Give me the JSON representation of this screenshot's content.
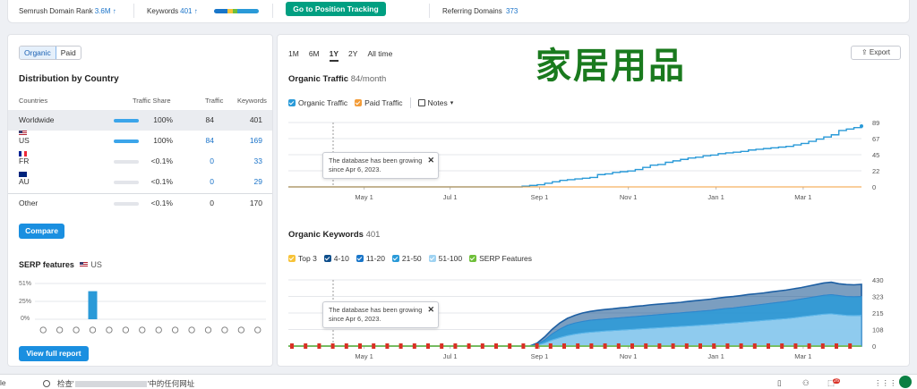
{
  "top": {
    "rank_label": "Semrush Domain Rank",
    "rank_value": "3.6M ↑",
    "keywords_label": "Keywords",
    "keywords_value": "401 ↑",
    "cta": "Go to Position Tracking",
    "ref_label": "Referring Domains",
    "ref_value": "373"
  },
  "left": {
    "toggle": [
      "Organic",
      "Paid"
    ],
    "dist_title": "Distribution by Country",
    "columns": [
      "Countries",
      "Traffic Share",
      "Traffic",
      "Keywords"
    ],
    "rows": [
      {
        "name": "Worldwide",
        "share": "100%",
        "share_value": 1.0,
        "traffic": "84",
        "keywords": "401",
        "flag": ""
      },
      {
        "name": "US",
        "share": "100%",
        "share_value": 1.0,
        "traffic": "84",
        "keywords": "169",
        "flag": "us"
      },
      {
        "name": "FR",
        "share": "<0.1%",
        "share_value": 0.0,
        "traffic": "0",
        "keywords": "33",
        "flag": "fr"
      },
      {
        "name": "AU",
        "share": "<0.1%",
        "share_value": 0.0,
        "traffic": "0",
        "keywords": "29",
        "flag": "au"
      },
      {
        "name": "Other",
        "share": "<0.1%",
        "share_value": 0.0,
        "traffic": "0",
        "keywords": "170",
        "flag": ""
      }
    ],
    "compare": "Compare",
    "serp_title": "SERP features",
    "serp_country": "US",
    "serp_yticks": [
      "51%",
      "25%",
      "0%"
    ],
    "view_report": "View full report"
  },
  "right": {
    "ranges": [
      "1M",
      "6M",
      "1Y",
      "2Y",
      "All time"
    ],
    "selected_range": "1Y",
    "heading_cn": "家居用品",
    "export": "Export",
    "ot_title": "Organic Traffic",
    "ot_value": "84/month",
    "ot_legend": [
      "Organic Traffic",
      "Paid Traffic"
    ],
    "notes": "Notes",
    "tip_line1": "The database has been growing",
    "tip_line2": "since Apr 6, 2023.",
    "ok_title": "Organic Keywords",
    "ok_value": "401",
    "ok_legend": [
      "Top 3",
      "4-10",
      "11-20",
      "21-50",
      "51-100",
      "SERP Features"
    ]
  },
  "colors": {
    "organic": "#2a9ad8",
    "paid": "#f39c38",
    "top3": "#f7c338",
    "pos4_10": "#0f4f8c",
    "pos11_20": "#1976c9",
    "pos21_50": "#2a9ad8",
    "pos51_100": "#9fd3f2",
    "serp": "#6fbf3a",
    "cta": "#009f81"
  },
  "bottom": {
    "left_fragment": "le",
    "search_prefix": "检查'",
    "search_suffix": "'中的任何网址",
    "badge": "26"
  },
  "chart_data": [
    {
      "type": "bar",
      "title": "SERP features",
      "ylim": [
        0,
        51
      ],
      "yticks": [
        "51%",
        "25%",
        "0%"
      ],
      "values": [
        0,
        0,
        0,
        40,
        0,
        0,
        0,
        0,
        0,
        0,
        0,
        0,
        0,
        0
      ]
    },
    {
      "type": "line",
      "title": "Organic Traffic",
      "x_labels": [
        "May 1",
        "Jul 1",
        "Sep 1",
        "Nov 1",
        "Jan 1",
        "Mar 1"
      ],
      "y_ticks": [
        "89",
        "67",
        "45",
        "22",
        "0"
      ],
      "ylim": [
        0,
        89
      ],
      "series": [
        {
          "name": "Organic Traffic",
          "values": [
            0,
            0,
            0,
            0,
            0,
            0,
            0,
            0,
            0,
            0,
            0,
            0,
            0,
            0,
            0,
            0,
            0,
            0,
            0,
            0,
            0,
            0,
            0,
            0,
            0,
            0,
            0,
            0,
            0,
            0,
            0,
            1,
            2,
            3,
            5,
            7,
            9,
            10,
            11,
            12,
            13,
            17,
            18,
            20,
            21,
            22,
            24,
            27,
            30,
            31,
            34,
            36,
            38,
            40,
            41,
            43,
            44,
            46,
            47,
            48,
            49,
            51,
            52,
            53,
            54,
            55,
            56,
            58,
            60,
            63,
            66,
            69,
            72,
            78,
            80,
            82,
            84
          ]
        },
        {
          "name": "Paid Traffic",
          "values": [
            0,
            0,
            0,
            0,
            0,
            0,
            0,
            0,
            0,
            0,
            0,
            0,
            0,
            0,
            0,
            0,
            0,
            0,
            0,
            0,
            0,
            0,
            0,
            0,
            0,
            0,
            0,
            0,
            0,
            0,
            0,
            0,
            0,
            0,
            0,
            0,
            0,
            0,
            0,
            0,
            0,
            0,
            0,
            0,
            0,
            0,
            0,
            0,
            0,
            0,
            0,
            0,
            0,
            0,
            0,
            0,
            0,
            0,
            0,
            0,
            0,
            0,
            0,
            0,
            0,
            0,
            0,
            0,
            0,
            0,
            0,
            0,
            0,
            0,
            0,
            0,
            0
          ]
        }
      ]
    },
    {
      "type": "area",
      "title": "Organic Keywords",
      "x_labels": [
        "May 1",
        "Jul 1",
        "Sep 1",
        "Nov 1",
        "Jan 1",
        "Mar 1"
      ],
      "y_ticks": [
        "430",
        "323",
        "215",
        "108",
        "0"
      ],
      "ylim": [
        0,
        430
      ],
      "series": [
        {
          "name": "4-10",
          "values": [
            0,
            0,
            0,
            0,
            0,
            0,
            0,
            0,
            0,
            0,
            0,
            0,
            0,
            0,
            0,
            0,
            0,
            0,
            0,
            0,
            0,
            0,
            0,
            0,
            0,
            0,
            0,
            0,
            0,
            0,
            0,
            0,
            0,
            20,
            60,
            110,
            150,
            180,
            200,
            215,
            225,
            232,
            238,
            242,
            248,
            252,
            258,
            262,
            268,
            272,
            276,
            280,
            284,
            290,
            295,
            300,
            305,
            312,
            318,
            322,
            328,
            335,
            340,
            345,
            352,
            358,
            364,
            372,
            380,
            390,
            400,
            410,
            415,
            405,
            400,
            398,
            401
          ]
        },
        {
          "name": "21-50",
          "values": [
            0,
            0,
            0,
            0,
            0,
            0,
            0,
            0,
            0,
            0,
            0,
            0,
            0,
            0,
            0,
            0,
            0,
            0,
            0,
            0,
            0,
            0,
            0,
            0,
            0,
            0,
            0,
            0,
            0,
            0,
            0,
            0,
            0,
            12,
            40,
            80,
            110,
            135,
            150,
            160,
            168,
            172,
            176,
            180,
            184,
            188,
            192,
            196,
            200,
            204,
            208,
            212,
            216,
            220,
            224,
            228,
            232,
            238,
            244,
            248,
            254,
            260,
            266,
            272,
            278,
            284,
            290,
            298,
            306,
            314,
            322,
            330,
            334,
            328,
            322,
            320,
            322
          ]
        },
        {
          "name": "51-100",
          "values": [
            0,
            0,
            0,
            0,
            0,
            0,
            0,
            0,
            0,
            0,
            0,
            0,
            0,
            0,
            0,
            0,
            0,
            0,
            0,
            0,
            0,
            0,
            0,
            0,
            0,
            0,
            0,
            0,
            0,
            0,
            0,
            0,
            0,
            6,
            20,
            40,
            55,
            68,
            78,
            85,
            90,
            94,
            98,
            101,
            104,
            107,
            110,
            113,
            116,
            119,
            122,
            125,
            128,
            131,
            134,
            137,
            140,
            144,
            148,
            151,
            155,
            159,
            163,
            167,
            171,
            175,
            179,
            184,
            190,
            196,
            202,
            208,
            210,
            205,
            200,
            198,
            200
          ]
        }
      ]
    }
  ]
}
